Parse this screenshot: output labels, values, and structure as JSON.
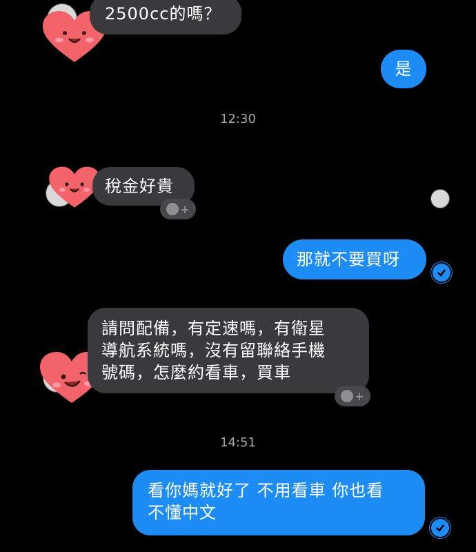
{
  "messages": [
    {
      "text": "2500cc的嗎？"
    },
    {
      "text": "是"
    },
    {
      "text": "稅金好貴"
    },
    {
      "text": "那就不要買呀"
    },
    {
      "text": "請問配備，有定速嗎，有衛星\n導航系統嗎，沒有留聯絡手機\n號碼，怎麼約看車，買車"
    },
    {
      "text": "看你媽就好了 不用看車 你也看\n不懂中文"
    }
  ],
  "timestamps": [
    "12:30",
    "14:51"
  ],
  "colors": {
    "incoming_bubble": "#3a3a3c",
    "outgoing_bubble": "#1e8cf5",
    "background": "#000000",
    "heart": "#f2646a"
  }
}
